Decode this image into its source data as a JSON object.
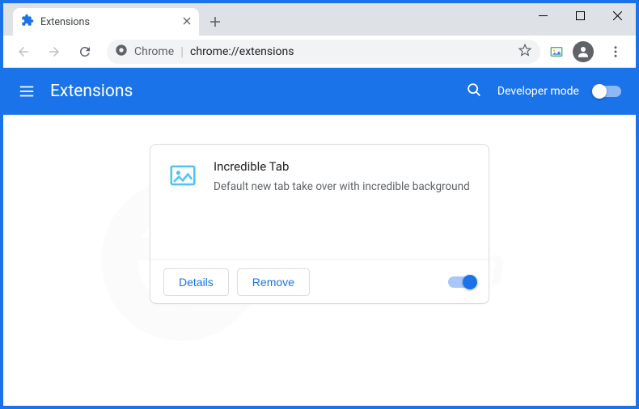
{
  "tab": {
    "title": "Extensions"
  },
  "omnibox": {
    "prefix": "Chrome",
    "url": "chrome://extensions"
  },
  "header": {
    "title": "Extensions",
    "devmode_label": "Developer mode",
    "devmode_on": false
  },
  "extension": {
    "name": "Incredible Tab",
    "description": "Default new tab take over with incredible background",
    "details_label": "Details",
    "remove_label": "Remove",
    "enabled": true
  },
  "watermark": "PCrisk.com"
}
